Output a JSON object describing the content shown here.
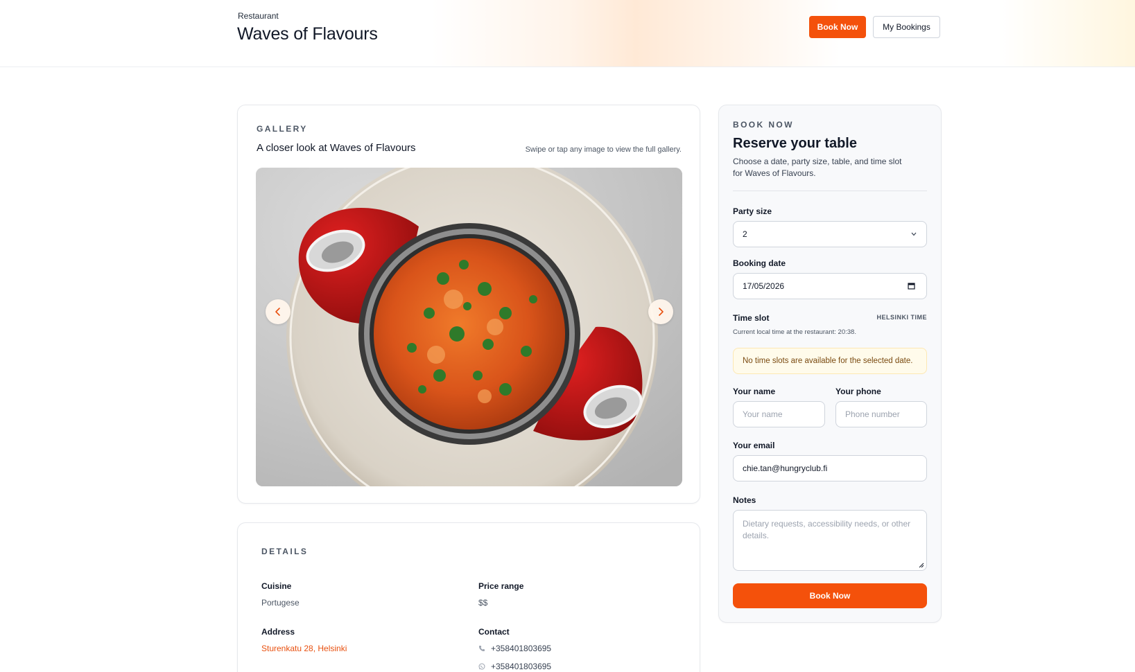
{
  "header": {
    "kicker": "Restaurant",
    "title": "Waves of Flavours",
    "book_now_label": "Book Now",
    "my_bookings_label": "My Bookings"
  },
  "gallery": {
    "eyebrow": "GALLERY",
    "title": "A closer look at Waves of Flavours",
    "hint": "Swipe or tap any image to view the full gallery.",
    "prev_icon": "chevron-left-icon",
    "next_icon": "chevron-right-icon"
  },
  "details": {
    "eyebrow": "DETAILS",
    "cuisine_label": "Cuisine",
    "cuisine_value": "Portugese",
    "price_label": "Price range",
    "price_value": "$$",
    "address_label": "Address",
    "address_value": "Sturenkatu 28, Helsinki",
    "contact_label": "Contact",
    "phone": "+358401803695",
    "whatsapp": "+358401803695",
    "phone_icon": "phone-icon",
    "whatsapp_icon": "whatsapp-icon"
  },
  "booking": {
    "eyebrow": "BOOK NOW",
    "title": "Reserve your table",
    "description": "Choose a date, party size, table, and time slot for Waves of Flavours.",
    "party_size_label": "Party size",
    "party_size_value": "2",
    "date_label": "Booking date",
    "date_value": "17/05/2026",
    "time_slot_label": "Time slot",
    "timezone_badge": "HELSINKI TIME",
    "local_time_hint": "Current local time at the restaurant: 20:38.",
    "no_slots_notice": "No time slots are available for the selected date.",
    "name_label": "Your name",
    "name_placeholder": "Your name",
    "phone_label": "Your phone",
    "phone_placeholder": "Phone number",
    "email_label": "Your email",
    "email_value": "chie.tan@hungryclub.fi",
    "notes_label": "Notes",
    "notes_placeholder": "Dietary requests, accessibility needs, or other details.",
    "submit_label": "Book Now"
  },
  "colors": {
    "accent": "#f4510b",
    "link": "#e8500f",
    "notice_bg": "#fffbeb"
  }
}
